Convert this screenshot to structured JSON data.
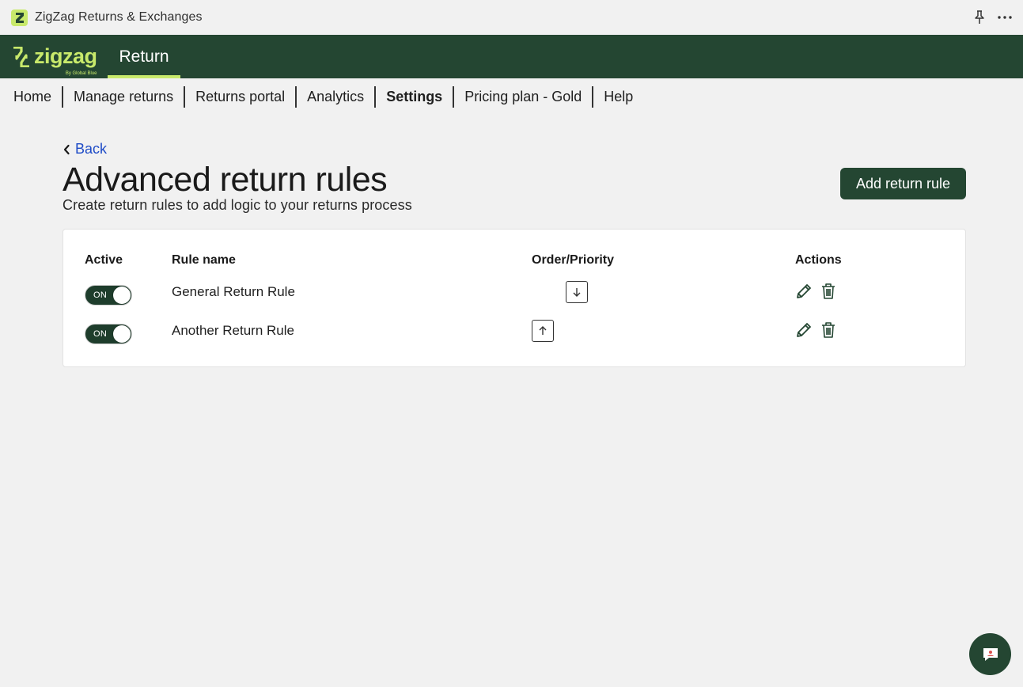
{
  "app": {
    "title": "ZigZag Returns & Exchanges",
    "icons": {
      "app": "zigzag-logo-icon",
      "pin": "pin-icon",
      "more": "more-horizontal-icon"
    }
  },
  "header": {
    "brand": "zigzag",
    "brand_sub": "By Global Blue",
    "tab": "Return",
    "colors": {
      "background": "#244632",
      "accent": "#c8e96b"
    }
  },
  "nav": {
    "items": [
      {
        "label": "Home"
      },
      {
        "label": "Manage returns"
      },
      {
        "label": "Returns portal"
      },
      {
        "label": "Analytics"
      },
      {
        "label": "Settings",
        "active": true
      },
      {
        "label": "Pricing plan - Gold"
      },
      {
        "label": "Help"
      }
    ]
  },
  "page": {
    "back": "Back",
    "title": "Advanced return rules",
    "subtitle": "Create return rules to add logic to your returns process",
    "add_button": "Add return rule"
  },
  "table": {
    "columns": {
      "active": "Active",
      "name": "Rule name",
      "order": "Order/Priority",
      "actions": "Actions"
    },
    "rows": [
      {
        "active": "ON",
        "name": "General Return Rule",
        "order_icon": "arrow-down-icon"
      },
      {
        "active": "ON",
        "name": "Another Return Rule",
        "order_icon": "arrow-up-icon"
      }
    ]
  },
  "chat": {
    "icon": "chat-icon"
  }
}
